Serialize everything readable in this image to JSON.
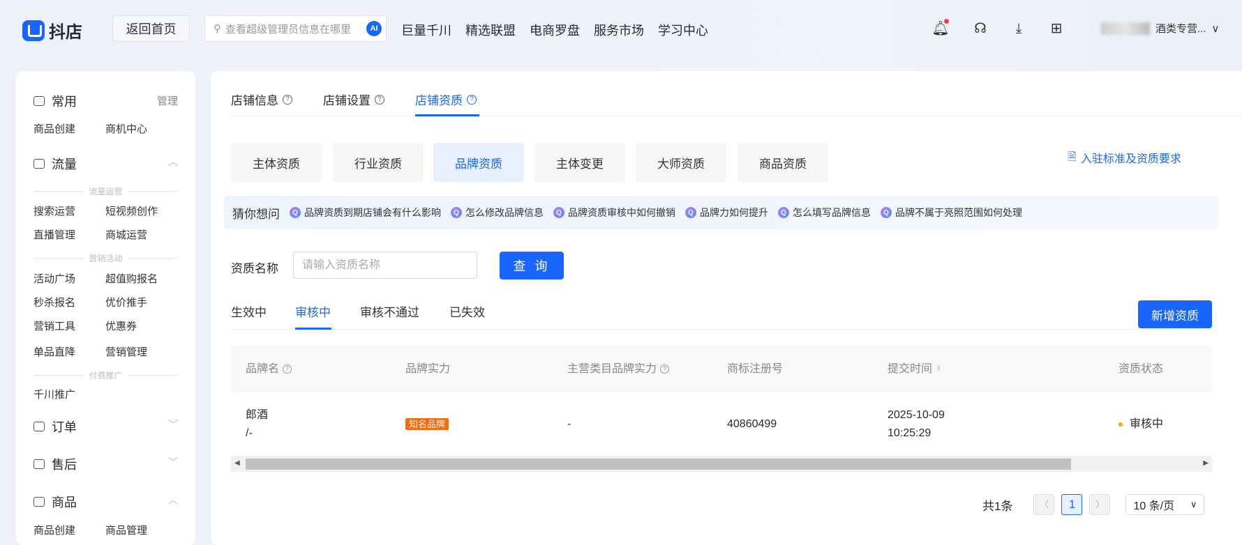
{
  "header": {
    "logo": "抖店",
    "home_button": "返回首页",
    "search_placeholder": "查看超级管理员信息在哪里",
    "ai_badge": "AI",
    "nav": [
      "巨量千川",
      "精选联盟",
      "电商罗盘",
      "服务市场",
      "学习中心"
    ],
    "user_name": "酒类专营..."
  },
  "sidebar": {
    "common": {
      "title": "常用",
      "manage": "管理",
      "items": [
        "商品创建",
        "商机中心"
      ]
    },
    "traffic": {
      "title": "流量",
      "groups": [
        {
          "label": "流量运营",
          "items": [
            "搜索运营",
            "短视频创作",
            "直播管理",
            "商城运营"
          ]
        },
        {
          "label": "营销活动",
          "items": [
            "活动广场",
            "超值购报名",
            "秒杀报名",
            "优价推手",
            "营销工具",
            "优惠券",
            "单品直降",
            "营销管理"
          ]
        },
        {
          "label": "付费推广",
          "items": [
            "千川推广"
          ]
        }
      ]
    },
    "order": {
      "title": "订单"
    },
    "aftersale": {
      "title": "售后"
    },
    "goods": {
      "title": "商品",
      "items": [
        "商品创建",
        "商品管理"
      ]
    }
  },
  "main": {
    "tabs": [
      "店铺信息",
      "店铺设置",
      "店铺资质"
    ],
    "subtabs": [
      "主体资质",
      "行业资质",
      "品牌资质",
      "主体变更",
      "大师资质",
      "商品资质"
    ],
    "requirements_link": "入驻标准及资质要求",
    "guess": {
      "title": "猜你想问",
      "questions": [
        "品牌资质到期店铺会有什么影响",
        "怎么修改品牌信息",
        "品牌资质审核中如何撤销",
        "品牌力如何提升",
        "怎么填写品牌信息",
        "品牌不属于亮照范围如何处理"
      ]
    },
    "query": {
      "label": "资质名称",
      "placeholder": "请输入资质名称",
      "button": "查 询"
    },
    "status_tabs": [
      "生效中",
      "审核中",
      "审核不通过",
      "已失效"
    ],
    "new_button": "新增资质",
    "table": {
      "columns": [
        "品牌名",
        "品牌实力",
        "主营类目品牌实力",
        "商标注册号",
        "提交时间",
        "资质状态"
      ],
      "rows": [
        {
          "brand": "郎酒",
          "brand_sub": "/-",
          "strength": "知名品牌",
          "category_strength": "-",
          "trademark": "40860499",
          "date": "2025-10-09",
          "time": "10:25:29",
          "status": "审核中"
        }
      ]
    },
    "pagination": {
      "total": "共1条",
      "current": "1",
      "page_size": "10 条/页"
    }
  }
}
